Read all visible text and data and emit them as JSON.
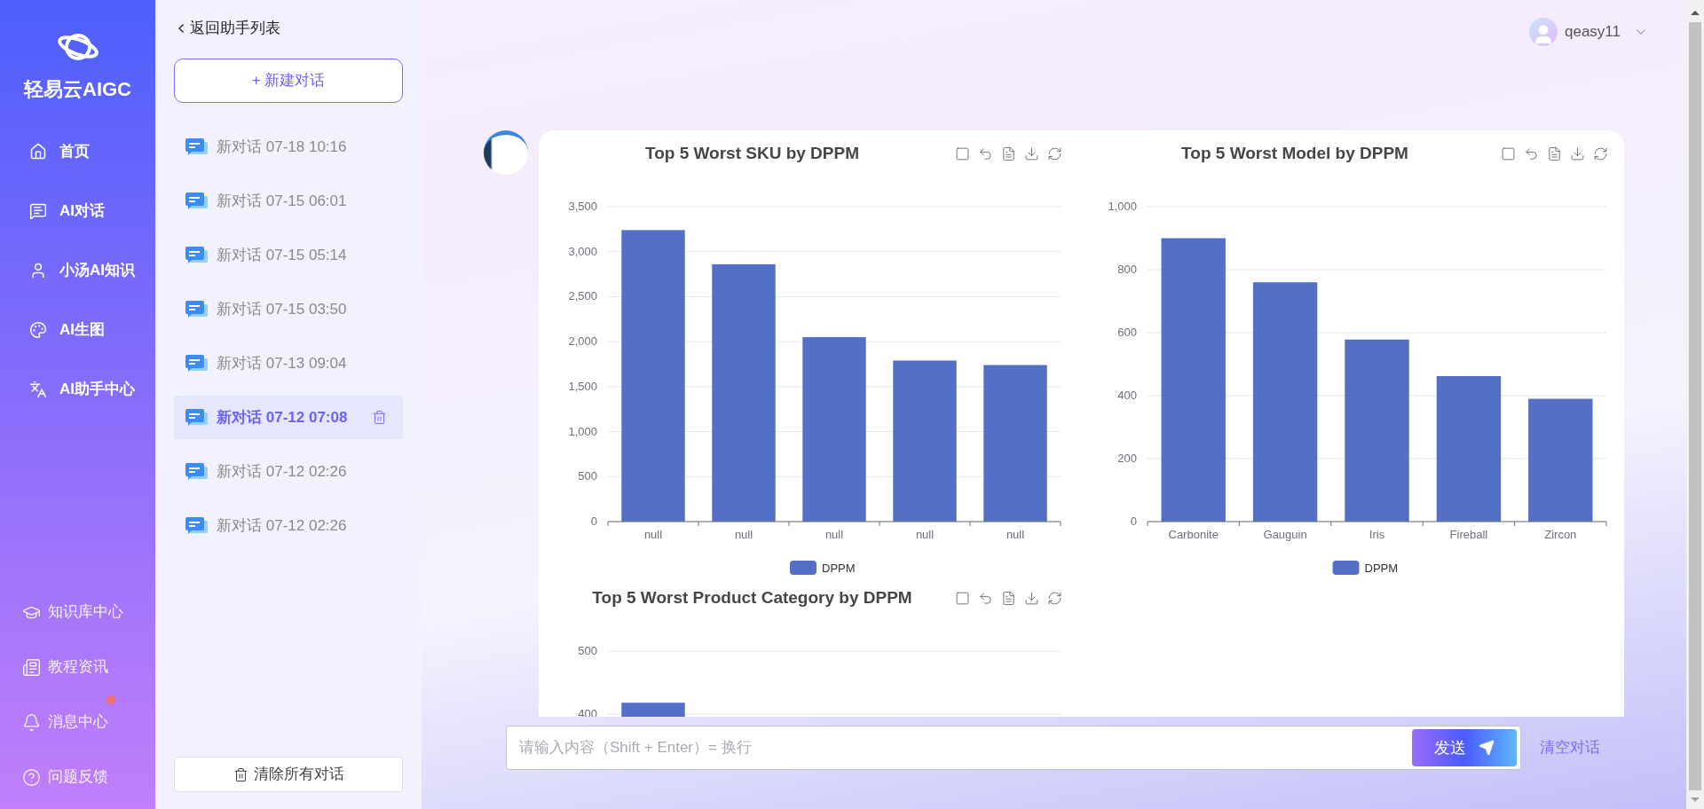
{
  "sidebar": {
    "brand": "轻易云AIGC",
    "nav": [
      {
        "label": "首页"
      },
      {
        "label": "AI对话"
      },
      {
        "label": "小汤AI知识"
      },
      {
        "label": "AI生图"
      },
      {
        "label": "AI助手中心"
      }
    ],
    "bottom": [
      {
        "label": "知识库中心",
        "badge": false
      },
      {
        "label": "教程资讯",
        "badge": false
      },
      {
        "label": "消息中心",
        "badge": true
      },
      {
        "label": "问题反馈",
        "badge": false
      }
    ]
  },
  "history": {
    "back": "返回助手列表",
    "new_button": "+ 新建对话",
    "items": [
      {
        "title": "新对话 07-18 10:16",
        "selected": false
      },
      {
        "title": "新对话 07-15 06:01",
        "selected": false
      },
      {
        "title": "新对话 07-15 05:14",
        "selected": false
      },
      {
        "title": "新对话 07-15 03:50",
        "selected": false
      },
      {
        "title": "新对话 07-13 09:04",
        "selected": false
      },
      {
        "title": "新对话 07-12 07:08",
        "selected": true
      },
      {
        "title": "新对话 07-12 02:26",
        "selected": false
      },
      {
        "title": "新对话 07-12 02:26",
        "selected": false
      }
    ],
    "clear_button": "清除所有对话"
  },
  "user": {
    "name": "qeasy11"
  },
  "charts": [
    {
      "chart_data": {
        "type": "bar",
        "title": "Top 5 Worst SKU by DPPM",
        "categories": [
          "null",
          "null",
          "null",
          "null",
          "null"
        ],
        "series": [
          {
            "name": "DPPM",
            "color": "#5470c6",
            "values": [
              3240,
              2860,
              2050,
              1790,
              1740
            ]
          }
        ],
        "ylim": [
          0,
          3500
        ],
        "grid": true,
        "yticks": [
          {
            "value": 3500,
            "label": "3,500"
          },
          {
            "value": 3000,
            "label": "3,000"
          },
          {
            "value": 2500,
            "label": "2,500"
          },
          {
            "value": 2000,
            "label": "2,000"
          },
          {
            "value": 1500,
            "label": "1,500"
          },
          {
            "value": 1000,
            "label": "1,000"
          },
          {
            "value": 500,
            "label": "500"
          },
          {
            "value": 0,
            "label": "0"
          }
        ]
      }
    },
    {
      "chart_data": {
        "type": "bar",
        "title": "Top 5 Worst Model by DPPM",
        "categories": [
          "Carbonite",
          "Gauguin",
          "Iris",
          "Fireball",
          "Zircon"
        ],
        "series": [
          {
            "name": "DPPM",
            "color": "#5470c6",
            "values": [
              900,
              760,
              578,
              462,
              390
            ]
          }
        ],
        "ylim": [
          0,
          1000
        ],
        "grid": true,
        "yticks": [
          {
            "value": 1000,
            "label": "1,000"
          },
          {
            "value": 800,
            "label": "800"
          },
          {
            "value": 600,
            "label": "600"
          },
          {
            "value": 400,
            "label": "400"
          },
          {
            "value": 200,
            "label": "200"
          },
          {
            "value": 0,
            "label": "0"
          }
        ]
      }
    },
    {
      "chart_data": {
        "type": "bar",
        "title": "Top 5 Worst Product Category by DPPM",
        "series": [
          {
            "color": "#5470c6",
            "values": [
              418
            ]
          }
        ],
        "ylim": [
          0,
          500
        ],
        "grid": true,
        "yticks": [
          {
            "value": 500,
            "label": "500"
          },
          {
            "value": 400,
            "label": "400"
          }
        ]
      }
    }
  ],
  "composer": {
    "placeholder": "请输入内容（Shift + Enter）= 换行",
    "send": "发送",
    "clear": "清空对话"
  }
}
